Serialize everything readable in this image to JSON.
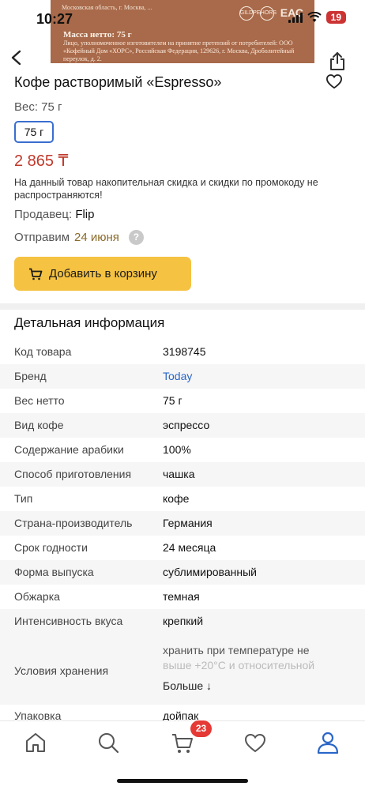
{
  "status_bar": {
    "time": "10:27",
    "battery": "19"
  },
  "hero": {
    "line1": "Московская область, г. Москва, ...",
    "weight_text": "Масса нетто: 75 г",
    "fine_text": "Лицо, уполномоченное изготовителем на принятие претензий от потребителей: ООО «Кофейный Дом «ХОРС», Российская Федерация, 129626, г. Москва, Дроболитейный переулок, д. 2.",
    "marks": [
      "GILDPE",
      "HORS",
      "ЕАС"
    ]
  },
  "product": {
    "title": "Кофе растворимый «Espresso»",
    "weight_label": "Вес: 75 г",
    "weight_option": "75 г",
    "price": "2 865 ₸",
    "notice": "На данный товар накопительная скидка и скидки по промокоду не распространяются!",
    "seller_label": "Продавец:",
    "seller_name": "Flip",
    "ship_label": "Отправим",
    "ship_date": "24 июня",
    "help_symbol": "?",
    "cart_button": "Добавить в корзину"
  },
  "details": {
    "title": "Детальная информация",
    "rows": [
      {
        "k": "Код товара",
        "v": "3198745"
      },
      {
        "k": "Бренд",
        "v": "Today"
      },
      {
        "k": "Вес нетто",
        "v": "75 г"
      },
      {
        "k": "Вид кофе",
        "v": "эспрессо"
      },
      {
        "k": "Содержание арабики",
        "v": "100%"
      },
      {
        "k": "Способ приготовления",
        "v": "чашка"
      },
      {
        "k": "Тип",
        "v": "кофе"
      },
      {
        "k": "Страна-производитель",
        "v": "Германия"
      },
      {
        "k": "Срок годности",
        "v": "24 месяца"
      },
      {
        "k": "Форма выпуска",
        "v": "сублимированный"
      },
      {
        "k": "Обжарка",
        "v": "темная"
      },
      {
        "k": "Интенсивность вкуса",
        "v": "крепкий"
      }
    ],
    "storage": {
      "k": "Условия хранения",
      "v1": "хранить при температуре не",
      "v2": "выше +20°С и относительной",
      "more": "Больше ↓"
    },
    "pack": {
      "k": "Упаковка",
      "v": "дойпак"
    }
  },
  "tabbar": {
    "cart_badge": "23"
  },
  "colors": {
    "accent": "#2a66c8",
    "price": "#c0392b",
    "button": "#f5c242",
    "badge": "#e53935"
  }
}
